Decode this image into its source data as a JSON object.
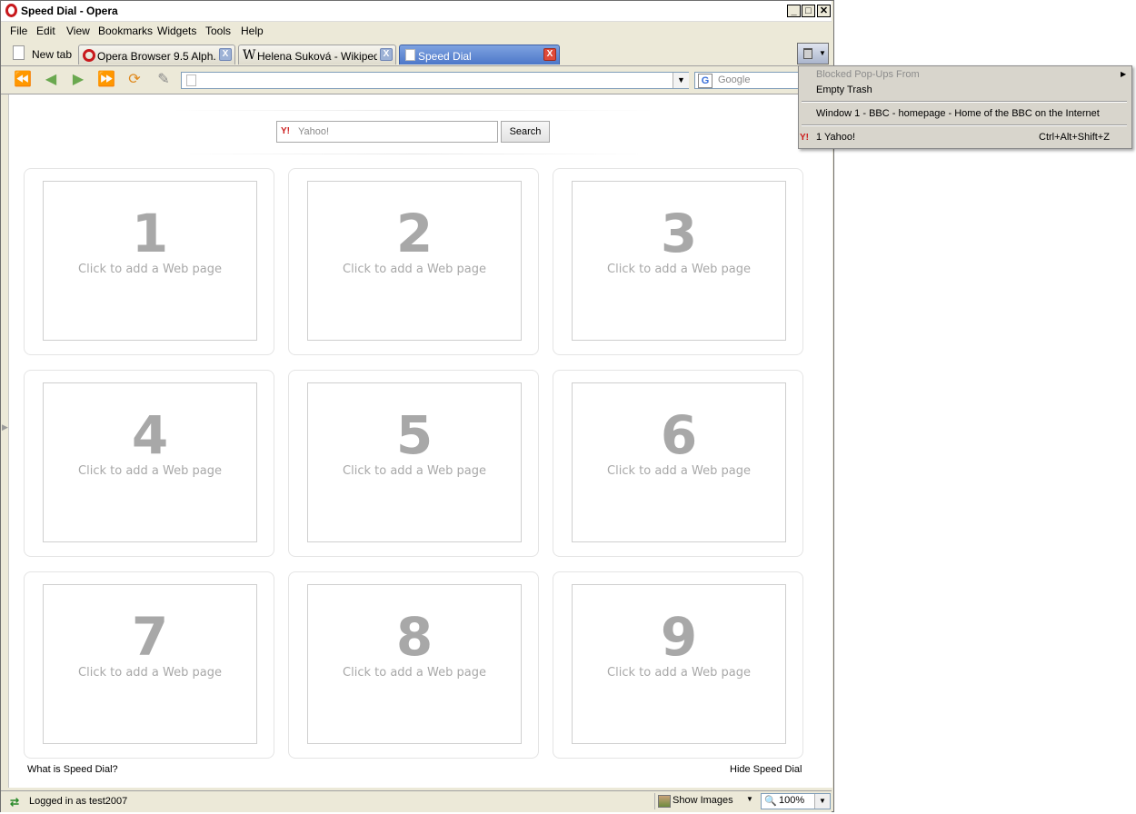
{
  "window": {
    "title": "Speed Dial - Opera",
    "minimize_glyph": "_",
    "maximize_glyph": "□",
    "close_glyph": "✕"
  },
  "menubar": {
    "items": [
      "File",
      "Edit",
      "View",
      "Bookmarks",
      "Widgets",
      "Tools",
      "Help"
    ]
  },
  "tabs": [
    {
      "label": "New tab",
      "icon": "page-icon",
      "active": false
    },
    {
      "label": "Opera Browser 9.5 Alph...",
      "icon": "opera-icon",
      "active": false
    },
    {
      "label": "Helena Suková - Wikipedi...",
      "icon": "wikipedia-icon",
      "active": false
    },
    {
      "label": "Speed Dial",
      "icon": "page-icon",
      "active": true
    }
  ],
  "tab_close_glyph": "X",
  "navbar": {
    "address_value": "",
    "search_placeholder": "Google"
  },
  "speed_dial": {
    "search_placeholder": "Yahoo!",
    "search_button": "Search",
    "search_logo": "Y!",
    "dials": [
      {
        "number": "1",
        "caption": "Click to add a Web page"
      },
      {
        "number": "2",
        "caption": "Click to add a Web page"
      },
      {
        "number": "3",
        "caption": "Click to add a Web page"
      },
      {
        "number": "4",
        "caption": "Click to add a Web page"
      },
      {
        "number": "5",
        "caption": "Click to add a Web page"
      },
      {
        "number": "6",
        "caption": "Click to add a Web page"
      },
      {
        "number": "7",
        "caption": "Click to add a Web page"
      },
      {
        "number": "8",
        "caption": "Click to add a Web page"
      },
      {
        "number": "9",
        "caption": "Click to add a Web page"
      }
    ],
    "what_is_link": "What is Speed Dial?",
    "hide_link": "Hide Speed Dial"
  },
  "statusbar": {
    "login_text": "Logged in as test2007",
    "show_images": "Show Images",
    "zoom": "100%"
  },
  "popup": {
    "blocked_label": "Blocked Pop-Ups From",
    "empty_trash": "Empty Trash",
    "closed_window": "Window 1 - BBC - homepage - Home of the BBC on the Internet",
    "closed_tab": "1 Yahoo!",
    "closed_tab_shortcut": "Ctrl+Alt+Shift+Z"
  },
  "colors": {
    "active_tab": "#4d78c9",
    "dial_text": "#a8a8a8",
    "chrome": "#ece9d8"
  }
}
